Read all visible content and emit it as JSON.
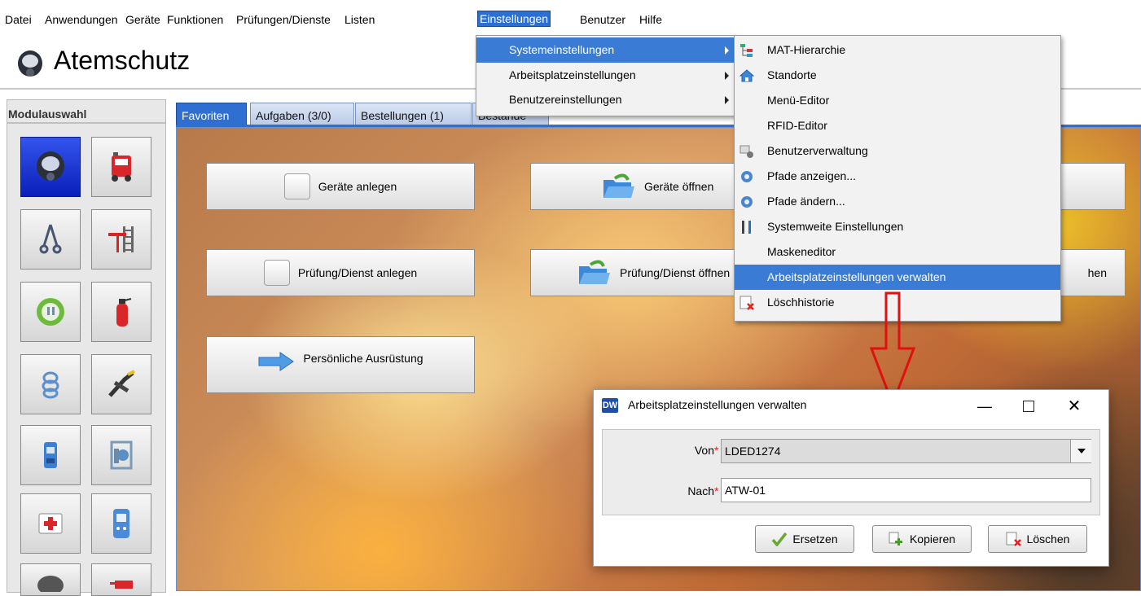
{
  "menubar": {
    "items": [
      {
        "label": "Datei"
      },
      {
        "label": "Anwendungen"
      },
      {
        "label": "Geräte"
      },
      {
        "label": "Funktionen"
      },
      {
        "label": "Prüfungen/Dienste"
      },
      {
        "label": "Listen"
      },
      {
        "label": "Einstellungen"
      },
      {
        "label": "Benutzer"
      },
      {
        "label": "Hilfe"
      }
    ]
  },
  "header": {
    "title": "Atemschutz",
    "icon": "breathing-mask-icon"
  },
  "sidebar": {
    "title": "Modulauswahl",
    "modules": [
      {
        "icon": "breathing-mask-icon"
      },
      {
        "icon": "fire-truck-icon"
      },
      {
        "icon": "harness-icon"
      },
      {
        "icon": "ladder-icon"
      },
      {
        "icon": "electric-plug-icon"
      },
      {
        "icon": "fire-extinguisher-icon"
      },
      {
        "icon": "rope-icon"
      },
      {
        "icon": "rescue-shears-icon"
      },
      {
        "icon": "radio-icon"
      },
      {
        "icon": "pump-icon"
      },
      {
        "icon": "first-aid-icon"
      },
      {
        "icon": "gas-detector-icon"
      },
      {
        "icon": "helmet-icon"
      },
      {
        "icon": "hose-icon"
      }
    ]
  },
  "tabs": [
    {
      "label": "Favoriten",
      "active": true
    },
    {
      "label": "Aufgaben (3/0)"
    },
    {
      "label": "Bestellungen (1)"
    },
    {
      "label": "Bestände"
    }
  ],
  "actions": {
    "geraete_anlegen": "Geräte anlegen",
    "geraete_oeffnen": "Geräte öffnen",
    "pruefung_anlegen": "Prüfung/Dienst anlegen",
    "pruefung_oeffnen": "Prüfung/Dienst öffnen",
    "pruefung_suchen_partial": "hen",
    "persoenliche_ausruestung": "Persönliche Ausrüstung"
  },
  "einstellungen_menu": {
    "items": [
      {
        "label": "Systemeinstellungen"
      },
      {
        "label": "Arbeitsplatzeinstellungen"
      },
      {
        "label": "Benutzereinstellungen"
      }
    ]
  },
  "system_submenu": {
    "items": [
      {
        "label": "MAT-Hierarchie",
        "icon": "hierarchy-tree-icon"
      },
      {
        "label": "Standorte",
        "icon": "house-icon"
      },
      {
        "label": "Menü-Editor",
        "icon": ""
      },
      {
        "label": "RFID-Editor",
        "icon": ""
      },
      {
        "label": "Benutzerverwaltung",
        "icon": "user-management-icon"
      },
      {
        "label": "Pfade anzeigen...",
        "icon": "gear-icon"
      },
      {
        "label": "Pfade ändern...",
        "icon": "gear-icon"
      },
      {
        "label": "Systemweite Einstellungen",
        "icon": "tools-icon"
      },
      {
        "label": "Maskeneditor",
        "icon": ""
      },
      {
        "label": "Arbeitsplatzeinstellungen verwalten",
        "icon": "",
        "highlighted": true
      },
      {
        "label": "Löschhistorie",
        "icon": "delete-history-icon"
      }
    ]
  },
  "dialog": {
    "app_badge": "DW",
    "title": "Arbeitsplatzeinstellungen verwalten",
    "von_label": "Von",
    "von_value": "LDED1274",
    "nach_label": "Nach",
    "nach_value": "ATW-01",
    "required_mark": "*",
    "buttons": {
      "ersetzen": "Ersetzen",
      "kopieren": "Kopieren",
      "loeschen": "Löschen"
    }
  },
  "colors": {
    "accent": "#2f6fd1",
    "menu_highlight": "#3a7bd5",
    "annotation_arrow": "#e01010",
    "required": "#dd2222"
  }
}
